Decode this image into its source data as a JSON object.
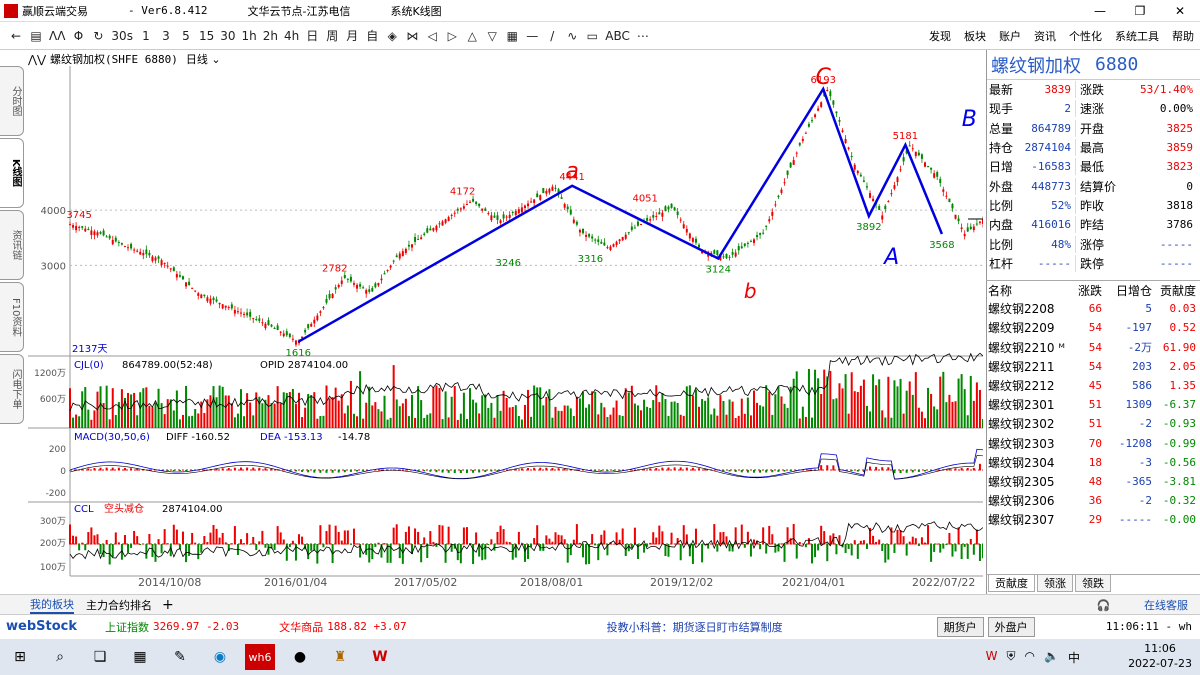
{
  "window": {
    "title": "赢顺云端交易",
    "version": "- Ver6.8.412",
    "server": "文华云节点-江苏电信",
    "system_chart": "系统K线图"
  },
  "toolbar": {
    "items": [
      "←",
      "▤",
      "ΛΛ",
      "Φ",
      "↻",
      "30s",
      "1",
      "3",
      "5",
      "15",
      "30",
      "1h",
      "2h",
      "4h",
      "日",
      "周",
      "月",
      "自",
      "◈",
      "⋈",
      "◁",
      "▷",
      "△",
      "▽",
      "▦",
      "—",
      "/",
      "∿",
      "▭",
      "ABC",
      "⋯"
    ],
    "menu": [
      "发现",
      "板块",
      "账户",
      "资讯",
      "个性化",
      "系统工具",
      "帮助"
    ]
  },
  "chart_header": {
    "symbol": "螺纹钢加权(SHFE 6880)",
    "period": "日线"
  },
  "side_tabs": [
    "分时图",
    "K线图",
    "资讯链",
    "F10资料",
    "闪电下单"
  ],
  "annotations": {
    "C": "C",
    "A": "A",
    "B": "B",
    "a": "a",
    "b": "b",
    "c": "c",
    "days": "2137天"
  },
  "panels": {
    "cjl": {
      "title": "CJL(0)",
      "vals": "864789.00(52:48)",
      "opid": "OPID 2874104.00",
      "ticks": [
        "1200万",
        "600万"
      ]
    },
    "macd": {
      "title": "MACD(30,50,6)",
      "diff": "DIFF -160.52",
      "dea": "DEA -153.13",
      "hist": "-14.78",
      "ticks": [
        "200",
        "0",
        "-200"
      ]
    },
    "ccl": {
      "title": "CCL",
      "status": "空头减仓",
      "value": "2874104.00",
      "ticks": [
        "300万",
        "200万",
        "100万"
      ]
    }
  },
  "chart_data": {
    "type": "line",
    "title": "",
    "xlabel": "",
    "ylabel": "",
    "x_ticks": [
      "2014/10/08",
      "2016/01/04",
      "2017/05/02",
      "2018/08/01",
      "2019/12/02",
      "2021/04/01",
      "2022/07/22"
    ],
    "y_ticks": [
      4000,
      3000
    ],
    "ylim": [
      1450,
      6500
    ],
    "series": [
      {
        "name": "",
        "x": [
          0,
          0.03,
          0.06,
          0.1,
          0.14,
          0.18,
          0.22,
          0.25,
          0.28,
          0.3,
          0.33,
          0.36,
          0.4,
          0.44,
          0.47,
          0.5,
          0.53,
          0.56,
          0.59,
          0.62,
          0.66,
          0.69,
          0.72,
          0.76,
          0.8,
          0.83,
          0.86,
          0.89,
          0.92,
          0.95,
          0.98,
          1
        ],
        "values": [
          3745,
          3600,
          3350,
          3100,
          2500,
          2200,
          1900,
          1616,
          2300,
          2782,
          2500,
          3200,
          3700,
          4172,
          3800,
          4100,
          4441,
          3600,
          3316,
          3700,
          4051,
          3300,
          3124,
          3600,
          5200,
          6193,
          4800,
          3892,
          5181,
          4600,
          3568,
          3839
        ]
      }
    ],
    "pivots": [
      {
        "label": "3745",
        "value": 3745,
        "pos": 0.01
      },
      {
        "label": "2782",
        "value": 2782,
        "pos": 0.29
      },
      {
        "label": "1616",
        "value": 1616,
        "pos": 0.25
      },
      {
        "label": "4172",
        "value": 4172,
        "pos": 0.43
      },
      {
        "label": "3246",
        "value": 3246,
        "pos": 0.48
      },
      {
        "label": "4441",
        "value": 4441,
        "pos": 0.55
      },
      {
        "label": "3316",
        "value": 3316,
        "pos": 0.57
      },
      {
        "label": "4051",
        "value": 4051,
        "pos": 0.63
      },
      {
        "label": "3124",
        "value": 3124,
        "pos": 0.71
      },
      {
        "label": "6193",
        "value": 6193,
        "pos": 0.825
      },
      {
        "label": "3892",
        "value": 3892,
        "pos": 0.875
      },
      {
        "label": "5181",
        "value": 5181,
        "pos": 0.915
      },
      {
        "label": "3568",
        "value": 3568,
        "pos": 0.955
      }
    ],
    "wave": [
      {
        "pos": 0.25,
        "value": 1616
      },
      {
        "pos": 0.55,
        "value": 4441
      },
      {
        "pos": 0.71,
        "value": 3124
      },
      {
        "pos": 0.825,
        "value": 6193
      },
      {
        "pos": 0.875,
        "value": 3892
      },
      {
        "pos": 0.915,
        "value": 5181
      },
      {
        "pos": 0.955,
        "value": 3568
      }
    ]
  },
  "quote": {
    "title": "螺纹钢加权",
    "code": "6880",
    "rows": [
      {
        "l1": "最新",
        "v1": "3839",
        "c1": "red",
        "l2": "涨跌",
        "v2": "53/1.40%",
        "c2": "red"
      },
      {
        "l1": "现手",
        "v1": "2",
        "c1": "blue",
        "l2": "速涨",
        "v2": "0.00%",
        "c2": ""
      },
      {
        "l1": "总量",
        "v1": "864789",
        "c1": "blue",
        "l2": "开盘",
        "v2": "3825",
        "c2": "red"
      },
      {
        "l1": "持仓",
        "v1": "2874104",
        "c1": "blue",
        "l2": "最高",
        "v2": "3859",
        "c2": "red"
      },
      {
        "l1": "日增",
        "v1": "-16583",
        "c1": "blue",
        "l2": "最低",
        "v2": "3823",
        "c2": "red"
      },
      {
        "l1": "外盘",
        "v1": "448773",
        "c1": "blue",
        "l2": "结算价",
        "v2": "0",
        "c2": ""
      },
      {
        "l1": "比例",
        "v1": "52%",
        "c1": "blue",
        "l2": "昨收",
        "v2": "3818",
        "c2": ""
      },
      {
        "l1": "内盘",
        "v1": "416016",
        "c1": "blue",
        "l2": "昨结",
        "v2": "3786",
        "c2": ""
      },
      {
        "l1": "比例",
        "v1": "48%",
        "c1": "blue",
        "l2": "涨停",
        "v2": "-----",
        "c2": "blue"
      },
      {
        "l1": "杠杆",
        "v1": "-----",
        "c1": "blue",
        "l2": "跌停",
        "v2": "-----",
        "c2": "blue"
      }
    ]
  },
  "contracts": {
    "headers": [
      "名称",
      "涨跌",
      "日增仓",
      "贡献度"
    ],
    "rows": [
      {
        "name": "螺纹钢2208",
        "chg": "66",
        "inc": "5",
        "con": "0.03",
        "cc": "red"
      },
      {
        "name": "螺纹钢2209",
        "chg": "54",
        "inc": "-197",
        "con": "0.52",
        "cc": "red"
      },
      {
        "name": "螺纹钢2210 ᴹ",
        "chg": "54",
        "inc": "-2万",
        "con": "61.90",
        "cc": "red"
      },
      {
        "name": "螺纹钢2211",
        "chg": "54",
        "inc": "203",
        "con": "2.05",
        "cc": "red"
      },
      {
        "name": "螺纹钢2212",
        "chg": "45",
        "inc": "586",
        "con": "1.35",
        "cc": "red"
      },
      {
        "name": "螺纹钢2301",
        "chg": "51",
        "inc": "1309",
        "con": "-6.37",
        "cc": "green"
      },
      {
        "name": "螺纹钢2302",
        "chg": "51",
        "inc": "-2",
        "con": "-0.93",
        "cc": "green"
      },
      {
        "name": "螺纹钢2303",
        "chg": "70",
        "inc": "-1208",
        "con": "-0.99",
        "cc": "green"
      },
      {
        "name": "螺纹钢2304",
        "chg": "18",
        "inc": "-3",
        "con": "-0.56",
        "cc": "green"
      },
      {
        "name": "螺纹钢2305",
        "chg": "48",
        "inc": "-365",
        "con": "-3.81",
        "cc": "green"
      },
      {
        "name": "螺纹钢2306",
        "chg": "36",
        "inc": "-2",
        "con": "-0.32",
        "cc": "green"
      },
      {
        "name": "螺纹钢2307",
        "chg": "29",
        "inc": "-----",
        "con": "-0.00",
        "cc": "green"
      }
    ],
    "tabs": [
      "贡献度",
      "领涨",
      "领跌"
    ]
  },
  "bottom_tabs": {
    "my_board": "我的板块",
    "main_rank": "主力合约排名",
    "add": "+",
    "service": "在线客服"
  },
  "status": {
    "brand": "webStock",
    "sh_label": "上证指数",
    "sh_val": "3269.97 -2.03",
    "wh_label": "文华商品",
    "wh_val": "188.82 +3.07",
    "tip": "投教小科普：期货逐日盯市结算制度",
    "btn1": "期货户",
    "btn2": "外盘户",
    "time": "11:06:11 - wh"
  },
  "taskbar": {
    "time": "11:06",
    "date": "2022-07-23",
    "ime": "中"
  }
}
